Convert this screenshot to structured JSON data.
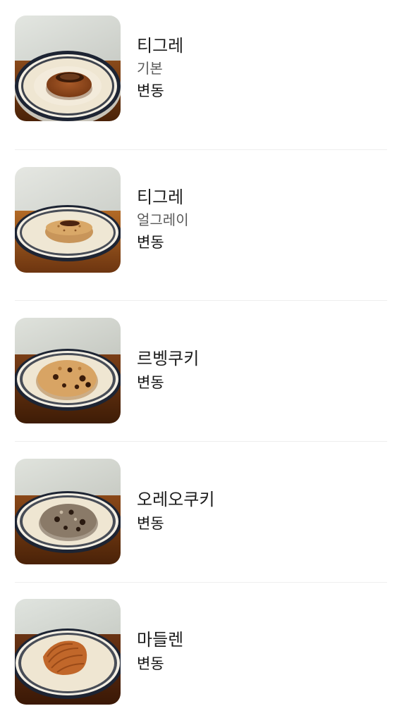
{
  "menu": {
    "items": [
      {
        "name": "티그레",
        "option": "기본",
        "price": "변동",
        "image": "tigre-plain-photo"
      },
      {
        "name": "티그레",
        "option": "얼그레이",
        "price": "변동",
        "image": "tigre-earlgrey-photo"
      },
      {
        "name": "르벵쿠키",
        "price": "변동",
        "image": "levain-cookie-photo"
      },
      {
        "name": "오레오쿠키",
        "price": "변동",
        "image": "oreo-cookie-photo"
      },
      {
        "name": "마들렌",
        "price": "변동",
        "image": "madeleine-photo"
      }
    ]
  },
  "colors": {
    "wall": "#d9dcd6",
    "table": "#7a3c12",
    "plate": "#f1ead9",
    "plate_rim": "#1d2433",
    "text_primary": "#1c1c1c",
    "text_secondary": "#5a5a5a",
    "divider": "#eeeeee"
  }
}
